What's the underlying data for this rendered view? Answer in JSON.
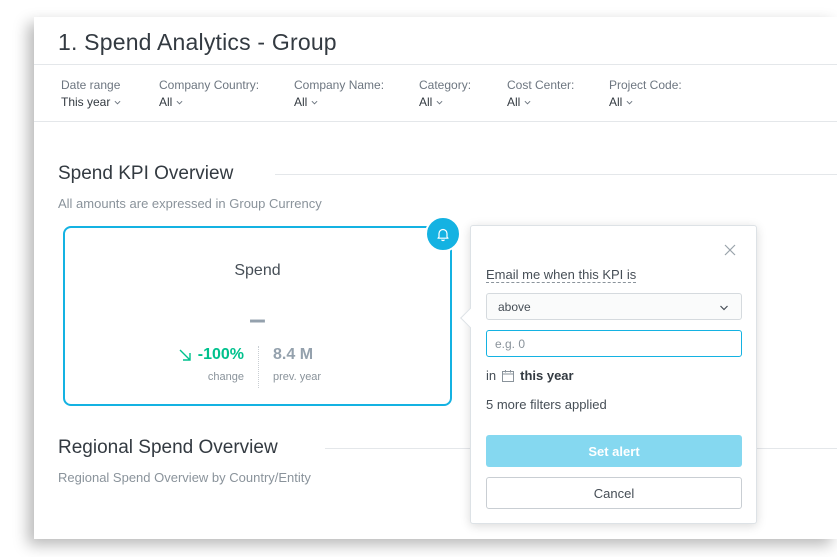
{
  "page": {
    "title": "1. Spend Analytics - Group"
  },
  "filters": [
    {
      "label": "Date range",
      "value": "This year"
    },
    {
      "label": "Company Country:",
      "value": "All"
    },
    {
      "label": "Company Name:",
      "value": "All"
    },
    {
      "label": "Category:",
      "value": "All"
    },
    {
      "label": "Cost Center:",
      "value": "All"
    },
    {
      "label": "Project Code:",
      "value": "All"
    }
  ],
  "kpi_section": {
    "title": "Spend KPI Overview",
    "subtitle": "All amounts are expressed in Group Currency"
  },
  "kpi_card": {
    "title": "Spend",
    "value": "–",
    "change_value": "-100%",
    "change_label": "change",
    "prev_value": "8.4 M",
    "prev_label": "prev. year"
  },
  "regional_section": {
    "title": "Regional Spend Overview",
    "subtitle": "Regional Spend Overview by Country/Entity"
  },
  "alert_popover": {
    "label": "Email me when this KPI is",
    "condition_value": "above",
    "threshold_placeholder": "e.g. 0",
    "in_prefix": "in",
    "period": "this year",
    "filters_applied": "5 more filters applied",
    "set_alert_label": "Set alert",
    "cancel_label": "Cancel"
  },
  "colors": {
    "accent": "#14b2e2",
    "positive": "#00c18d",
    "button_disabled": "#85d8f0"
  }
}
